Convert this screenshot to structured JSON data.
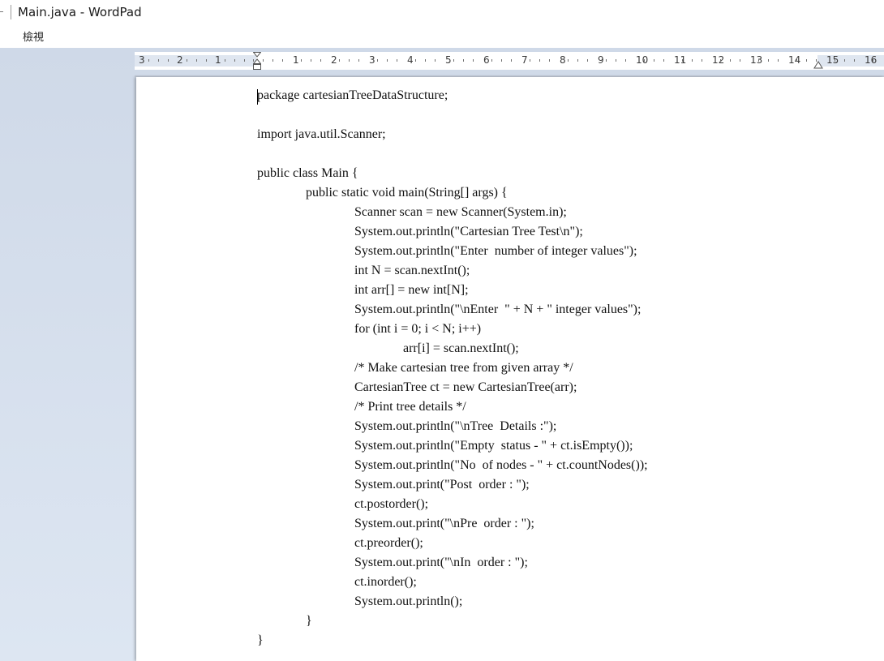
{
  "window": {
    "title": "Main.java - WordPad"
  },
  "menu": {
    "items": [
      {
        "label": "檢視"
      }
    ]
  },
  "ruler": {
    "labels": [
      "3",
      "2",
      "1",
      "1",
      "2",
      "3",
      "4",
      "5",
      "6",
      "7",
      "8",
      "9",
      "10",
      "11",
      "12",
      "13",
      "14",
      "15",
      "16"
    ]
  },
  "document": {
    "lines": [
      "package cartesianTreeDataStructure;",
      "",
      "import java.util.Scanner;",
      "",
      "public class Main {",
      "\tpublic static void main(String[] args) {",
      "\t\tScanner scan = new Scanner(System.in);",
      "\t\tSystem.out.println(\"Cartesian Tree Test\\n\");",
      "\t\tSystem.out.println(\"Enter  number of integer values\");",
      "\t\tint N = scan.nextInt();",
      "\t\tint arr[] = new int[N];",
      "\t\tSystem.out.println(\"\\nEnter  \" + N + \" integer values\");",
      "\t\tfor (int i = 0; i < N; i++)",
      "\t\t\tarr[i] = scan.nextInt();",
      "\t\t/* Make cartesian tree from given array */",
      "\t\tCartesianTree ct = new CartesianTree(arr);",
      "\t\t/* Print tree details */",
      "\t\tSystem.out.println(\"\\nTree  Details :\");",
      "\t\tSystem.out.println(\"Empty  status - \" + ct.isEmpty());",
      "\t\tSystem.out.println(\"No  of nodes - \" + ct.countNodes());",
      "\t\tSystem.out.print(\"Post  order : \");",
      "\t\tct.postorder();",
      "\t\tSystem.out.print(\"\\nPre  order : \");",
      "\t\tct.preorder();",
      "\t\tSystem.out.print(\"\\nIn  order : \");",
      "\t\tct.inorder();",
      "\t\tSystem.out.println();",
      "\t}",
      "}"
    ]
  }
}
